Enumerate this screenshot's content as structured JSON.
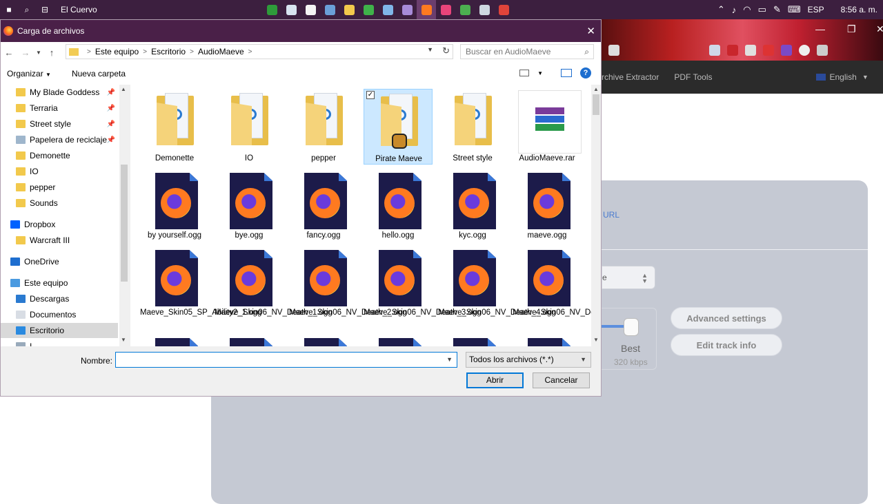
{
  "taskbar": {
    "window_title": "El Cuervo",
    "apps": [
      {
        "name": "app-green-icon",
        "color": "#2e9b3a"
      },
      {
        "name": "app-cloud-icon",
        "color": "#d8e4f0"
      },
      {
        "name": "calculator-icon",
        "color": "#f4f4f4"
      },
      {
        "name": "steam-icon",
        "color": "#6aa0d8"
      },
      {
        "name": "file-explorer-icon",
        "color": "#f2c94c"
      },
      {
        "name": "app-green2-icon",
        "color": "#3fb24a"
      },
      {
        "name": "app-blue-icon",
        "color": "#7fb6e8"
      },
      {
        "name": "app-discord-icon",
        "color": "#a78bd8"
      },
      {
        "name": "firefox-icon",
        "color": "#ff7a20"
      },
      {
        "name": "app-pink-icon",
        "color": "#e8447a"
      },
      {
        "name": "app-green3-icon",
        "color": "#4caf50"
      },
      {
        "name": "app-shield-icon",
        "color": "#cfd8e0"
      },
      {
        "name": "app-red-icon",
        "color": "#e0443a"
      }
    ],
    "tray": {
      "language": "ESP",
      "time": "8:56 a. m."
    }
  },
  "background_page": {
    "nav_items": [
      "rchive Extractor",
      "PDF Tools"
    ],
    "language_selector": "English",
    "url_link": "URL",
    "select_value": "e",
    "quality_label": "Best",
    "quality_kbps": "320 kbps",
    "advanced_settings_label": "Advanced settings",
    "edit_track_info_label": "Edit track info",
    "colors": {
      "card": "#c5c9d3",
      "nav": "#2b2b2b",
      "link": "#4a7bd0"
    }
  },
  "dialog": {
    "title": "Carga de archivos",
    "breadcrumb": [
      "Este equipo",
      "Escritorio",
      "AudioMaeve"
    ],
    "search_placeholder": "Buscar en AudioMaeve",
    "organize_label": "Organizar",
    "new_folder_label": "Nueva carpeta",
    "help_glyph": "?",
    "nav_items": [
      {
        "label": "My Blade Goddess",
        "icon": "folder-icon",
        "pinned": true
      },
      {
        "label": "Terraria",
        "icon": "folder-icon",
        "pinned": true
      },
      {
        "label": "Street style",
        "icon": "folder-icon",
        "pinned": true
      },
      {
        "label": "Papelera de reciclaje",
        "icon": "recycle-bin-icon",
        "pinned": true
      },
      {
        "label": "Demonette",
        "icon": "folder-icon",
        "pinned": false
      },
      {
        "label": "IO",
        "icon": "folder-icon",
        "pinned": false
      },
      {
        "label": "pepper",
        "icon": "folder-icon",
        "pinned": false
      },
      {
        "label": "Sounds",
        "icon": "folder-icon",
        "pinned": false
      },
      {
        "label": "Dropbox",
        "icon": "dropbox-icon",
        "pinned": false
      },
      {
        "label": "Warcraft III",
        "icon": "folder-icon",
        "pinned": false
      },
      {
        "label": "OneDrive",
        "icon": "onedrive-icon",
        "pinned": false
      },
      {
        "label": "Este equipo",
        "icon": "computer-icon",
        "pinned": false
      },
      {
        "label": "Descargas",
        "icon": "downloads-icon",
        "pinned": false
      },
      {
        "label": "Documentos",
        "icon": "documents-icon",
        "pinned": false
      },
      {
        "label": "Escritorio",
        "icon": "desktop-icon",
        "pinned": false,
        "selected": true
      },
      {
        "label": "I...",
        "icon": "image-icon",
        "pinned": false
      }
    ],
    "files": [
      {
        "label": "Demonette",
        "type": "folder"
      },
      {
        "label": "IO",
        "type": "folder"
      },
      {
        "label": "pepper",
        "type": "folder"
      },
      {
        "label": "Pirate Maeve",
        "type": "folder",
        "selected": true
      },
      {
        "label": "Street style",
        "type": "folder"
      },
      {
        "label": "AudioMaeve.rar",
        "type": "rar"
      },
      {
        "label": "by yourself.ogg",
        "type": "ogg"
      },
      {
        "label": "bye.ogg",
        "type": "ogg"
      },
      {
        "label": "fancy.ogg",
        "type": "ogg"
      },
      {
        "label": "hello.ogg",
        "type": "ogg"
      },
      {
        "label": "kyc.ogg",
        "type": "ogg"
      },
      {
        "label": "maeve.ogg",
        "type": "ogg"
      },
      {
        "label": "Maeve_Skin05_SP_Ability2_1.ogg",
        "type": "ogg"
      },
      {
        "label": "Maeve_Skin06_NV_Death_1.ogg",
        "type": "ogg"
      },
      {
        "label": "Maeve_Skin06_NV_Death_2.ogg",
        "type": "ogg"
      },
      {
        "label": "Maeve_Skin06_NV_Death_3.ogg",
        "type": "ogg"
      },
      {
        "label": "Maeve_Skin06_NV_Death_4.ogg",
        "type": "ogg"
      },
      {
        "label": "Maeve_Skin06_NV_Death_5.ogg",
        "type": "ogg"
      },
      {
        "label": "",
        "type": "ogg"
      },
      {
        "label": "",
        "type": "ogg"
      },
      {
        "label": "",
        "type": "ogg"
      },
      {
        "label": "",
        "type": "ogg"
      },
      {
        "label": "",
        "type": "ogg"
      },
      {
        "label": "",
        "type": "ogg"
      }
    ],
    "filename_label": "Nombre:",
    "filename_value": "",
    "filter_value": "Todos los archivos (*.*)",
    "open_label": "Abrir",
    "cancel_label": "Cancelar"
  }
}
